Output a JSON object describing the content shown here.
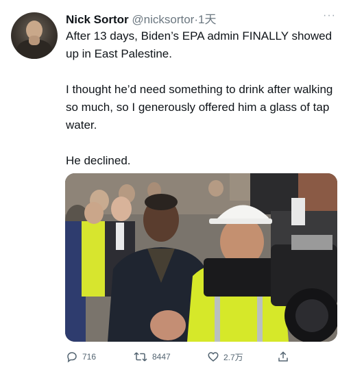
{
  "tweet": {
    "author_name": "Nick Sortor",
    "author_handle": "@nicksortor",
    "separator": "·",
    "time": "1天",
    "more_icon": "more-horizontal-icon",
    "paragraphs": [
      "After 13 days, Biden’s EPA admin FINALLY showed up in East Palestine.",
      "I thought he’d need something to drink after walking so much, so I generously offered him a glass of tap water.",
      "He declined."
    ],
    "media": {
      "type": "photo"
    },
    "actions": {
      "replies": "716",
      "retweets": "8447",
      "likes": "2.7万",
      "reply_icon": "reply-icon",
      "retweet_icon": "retweet-icon",
      "like_icon": "heart-icon",
      "share_icon": "share-icon"
    }
  },
  "colors": {
    "text": "#0f1419",
    "secondary": "#6b7780",
    "hard_hat": "#f4f4f2",
    "safety_vest": "#d6e829"
  }
}
